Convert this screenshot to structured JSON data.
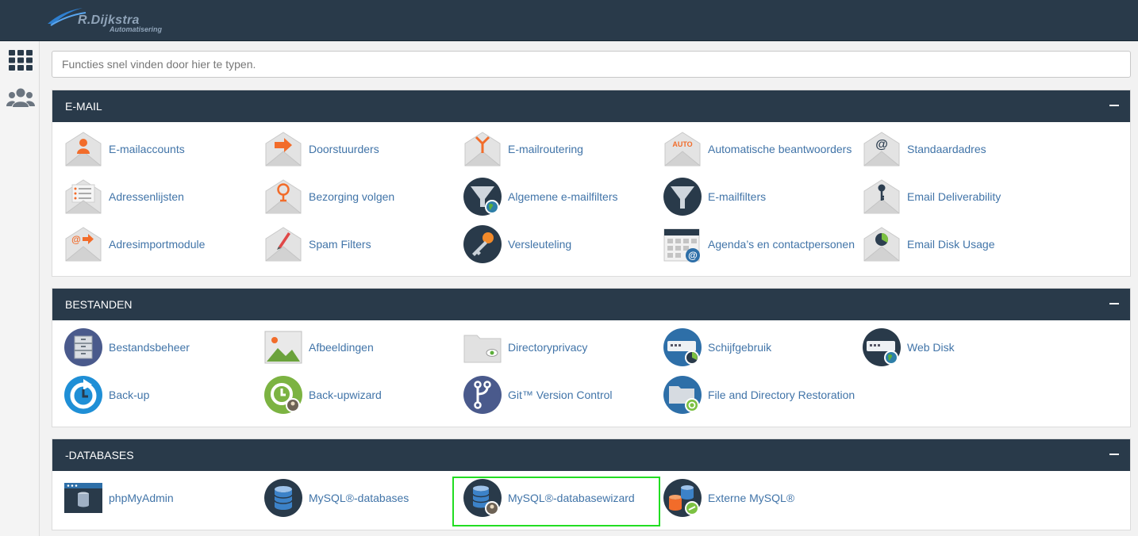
{
  "brand": {
    "name": "R.Dijkstra",
    "sub": "Automatisering"
  },
  "search": {
    "placeholder": "Functies snel vinden door hier te typen."
  },
  "rail": [
    {
      "icon": "grid-icon"
    },
    {
      "icon": "users-icon"
    }
  ],
  "sections": {
    "email": {
      "title": "E-MAIL",
      "items": [
        {
          "label": "E-mailaccounts",
          "icon": "email-accounts-icon"
        },
        {
          "label": "Doorstuurders",
          "icon": "forwarders-icon"
        },
        {
          "label": "E-mailroutering",
          "icon": "email-routing-icon"
        },
        {
          "label": "Automatische beantwoorders",
          "icon": "autoresponders-icon"
        },
        {
          "label": "Standaardadres",
          "icon": "default-address-icon"
        },
        {
          "label": "Adressenlijsten",
          "icon": "mailing-lists-icon"
        },
        {
          "label": "Bezorging volgen",
          "icon": "track-delivery-icon"
        },
        {
          "label": "Algemene e-mailfilters",
          "icon": "global-filters-icon"
        },
        {
          "label": "E-mailfilters",
          "icon": "email-filters-icon"
        },
        {
          "label": "Email Deliverability",
          "icon": "deliverability-icon"
        },
        {
          "label": "Adresimportmodule",
          "icon": "address-importer-icon"
        },
        {
          "label": "Spam Filters",
          "icon": "spam-filters-icon"
        },
        {
          "label": "Versleuteling",
          "icon": "encryption-icon"
        },
        {
          "label": "Agenda’s en contactpersonen",
          "icon": "calendar-contacts-icon"
        },
        {
          "label": "Email Disk Usage",
          "icon": "email-disk-usage-icon"
        }
      ]
    },
    "files": {
      "title": "BESTANDEN",
      "items": [
        {
          "label": "Bestandsbeheer",
          "icon": "file-manager-icon"
        },
        {
          "label": "Afbeeldingen",
          "icon": "images-icon"
        },
        {
          "label": "Directoryprivacy",
          "icon": "directory-privacy-icon"
        },
        {
          "label": "Schijfgebruik",
          "icon": "disk-usage-icon"
        },
        {
          "label": "Web Disk",
          "icon": "web-disk-icon"
        },
        {
          "label": "Back-up",
          "icon": "backup-icon"
        },
        {
          "label": "Back-upwizard",
          "icon": "backup-wizard-icon"
        },
        {
          "label": "Git™ Version Control",
          "icon": "git-icon"
        },
        {
          "label": "File and Directory Restoration",
          "icon": "restoration-icon"
        }
      ]
    },
    "databases": {
      "title": "-DATABASES",
      "items": [
        {
          "label": "phpMyAdmin",
          "icon": "phpmyadmin-icon"
        },
        {
          "label": "MySQL®-databases",
          "icon": "mysql-databases-icon"
        },
        {
          "label": "MySQL®-databasewizard",
          "icon": "mysql-wizard-icon"
        },
        {
          "label": "Externe MySQL®",
          "icon": "remote-mysql-icon"
        }
      ]
    }
  },
  "colors": {
    "header": "#293a4a",
    "link": "#4174a8",
    "highlight": "#22dd22"
  }
}
